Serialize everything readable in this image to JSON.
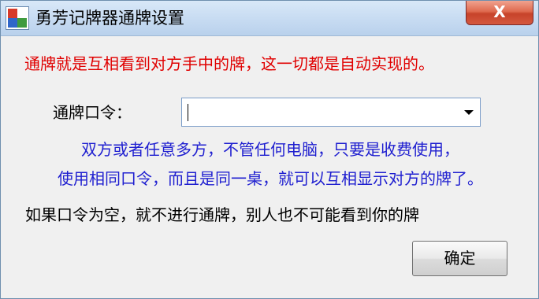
{
  "window": {
    "title": "勇芳记牌器通牌设置",
    "close_label": "X",
    "app_icon": "app-icon"
  },
  "dialog": {
    "notice_red": "通牌就是互相看到对方手中的牌，这一切都是自动实现的。",
    "command_label": "通牌口令：",
    "command_value": "",
    "info_line1": "双方或者任意多方，不管任何电脑，只要是收费使用，",
    "info_line2": "使用相同口令，而且是同一桌，就可以互相显示对方的牌了。",
    "empty_note": "如果口令为空，就不进行通牌，别人也不可能看到你的牌",
    "ok_label": "确定"
  },
  "colors": {
    "notice_red": "#e00000",
    "info_blue": "#1f1fd0",
    "close_red": "#c7432a",
    "titlebar": "#c8dcf2"
  }
}
